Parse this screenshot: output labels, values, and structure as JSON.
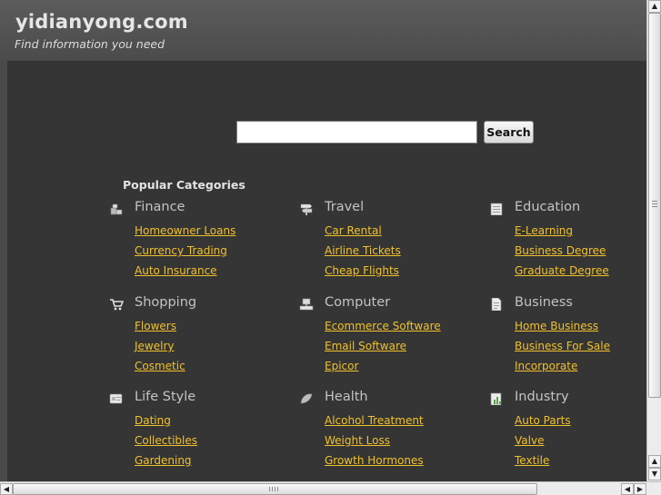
{
  "site": {
    "title": "yidianyong.com",
    "tagline": "Find information you need"
  },
  "search": {
    "value": "",
    "button_label": "Search"
  },
  "popular": {
    "title": "Popular Categories"
  },
  "categories": [
    {
      "title": "Finance",
      "icon": "coins-icon",
      "links": [
        "Homeowner Loans",
        "Currency Trading",
        "Auto Insurance"
      ]
    },
    {
      "title": "Travel",
      "icon": "signpost-icon",
      "links": [
        "Car Rental",
        "Airline Tickets",
        "Cheap Flights"
      ]
    },
    {
      "title": "Education",
      "icon": "book-icon",
      "links": [
        "E-Learning",
        "Business Degree",
        "Graduate Degree"
      ]
    },
    {
      "title": "Shopping",
      "icon": "cart-icon",
      "links": [
        "Flowers",
        "Jewelry",
        "Cosmetic"
      ]
    },
    {
      "title": "Computer",
      "icon": "computer-icon",
      "links": [
        "Ecommerce Software",
        "Email Software",
        "Epicor"
      ]
    },
    {
      "title": "Business",
      "icon": "document-icon",
      "links": [
        "Home Business",
        "Business For Sale",
        "Incorporate"
      ]
    },
    {
      "title": "Life Style",
      "icon": "card-icon",
      "links": [
        "Dating",
        "Collectibles",
        "Gardening"
      ]
    },
    {
      "title": "Health",
      "icon": "leaf-icon",
      "links": [
        "Alcohol Treatment",
        "Weight Loss",
        "Growth Hormones"
      ]
    },
    {
      "title": "Industry",
      "icon": "chart-doc-icon",
      "links": [
        "Auto Parts",
        "Valve",
        "Textile"
      ]
    }
  ],
  "colors": {
    "header": "#555555",
    "content": "#353535",
    "link": "#f0c12b",
    "category_title": "#c3c3c3"
  }
}
